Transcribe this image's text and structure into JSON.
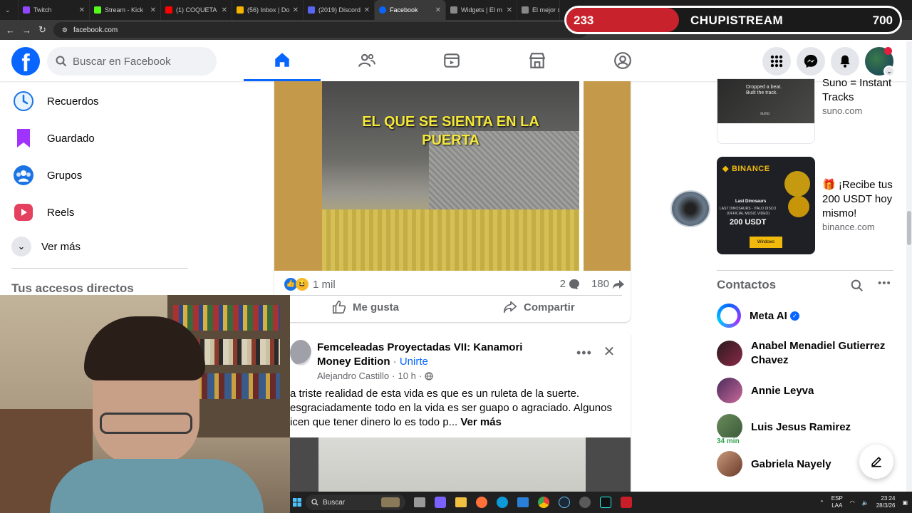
{
  "browser": {
    "tabs": [
      {
        "label": "Twitch",
        "color": "#9146ff"
      },
      {
        "label": "Stream - Kick",
        "color": "#53fc18"
      },
      {
        "label": "(1) COQUETA",
        "color": "#ff0000"
      },
      {
        "label": "(56) Inbox | Do",
        "color": "#f4b400"
      },
      {
        "label": "(2019) Discord",
        "color": "#5865f2"
      },
      {
        "label": "Facebook",
        "color": "#0866ff",
        "active": true
      },
      {
        "label": "Widgets | El m",
        "color": "#888888"
      },
      {
        "label": "El mejor so",
        "color": "#888888"
      }
    ],
    "url": "facebook.com"
  },
  "overlay": {
    "left_count": "233",
    "channel": "CHUPISTREAM",
    "right_count": "700"
  },
  "header": {
    "search_placeholder": "Buscar en Facebook"
  },
  "left_nav": {
    "items": [
      {
        "label": "Recuerdos"
      },
      {
        "label": "Guardado"
      },
      {
        "label": "Grupos"
      },
      {
        "label": "Reels"
      }
    ],
    "see_more": "Ver más",
    "shortcuts_title": "Tus accesos directos"
  },
  "post1": {
    "video_caption_line1": "EL QUE SE SIENTA EN LA",
    "video_caption_line2": "PUERTA",
    "reactions_count": "1 mil",
    "comments_count": "2",
    "shares_count": "180",
    "like_label": "Me gusta",
    "share_label": "Compartir"
  },
  "post2": {
    "group_name": "Femceleadas Proyectadas VII: Kanamori Money Edition",
    "join_label": "Unirte",
    "author": "Alejandro Castillo",
    "time": "10 h",
    "text_line1": "a triste realidad de esta vida es que es un ruleta de la suerte.",
    "text_line2": "esgraciadamente todo en la vida es ser guapo o agraciado. Algunos",
    "text_line3": "icen que tener dinero lo es todo p...",
    "see_more": "Ver más"
  },
  "ads": [
    {
      "title": "Suno = Instant Tracks",
      "domain": "suno.com",
      "img_text1": "Dropped a beat.",
      "img_text2": "Built the track.",
      "img_text3": "suno"
    },
    {
      "title": "🎁 ¡Recibe tus 200 USDT hoy mismo!",
      "domain": "binance.com",
      "img_brand": "BINANCE",
      "img_sub1": "Last Dinosaurs",
      "img_sub2": "LAST DINOSAURS - ITALO DISCO",
      "img_sub3": "(OFFICIAL MUSIC VIDEO)",
      "img_amount": "200 USDT",
      "img_windows": "Windows"
    }
  ],
  "contacts": {
    "title": "Contactos",
    "items": [
      {
        "name": "Meta AI",
        "verified": true
      },
      {
        "name": "Anabel Menadiel Gutierrez Chavez"
      },
      {
        "name": "Annie Leyva"
      },
      {
        "name": "Luis Jesus Ramirez",
        "badge": "34 min"
      },
      {
        "name": "Gabriela Nayely"
      }
    ]
  },
  "taskbar": {
    "search_label": "Buscar",
    "lang_top": "ESP",
    "lang_bottom": "LAA",
    "time": "23:24",
    "date": "28/3/26"
  },
  "colors": {
    "fb_blue": "#0866ff",
    "fb_bg": "#f0f2f5",
    "reels_accent": "#e4405f"
  }
}
